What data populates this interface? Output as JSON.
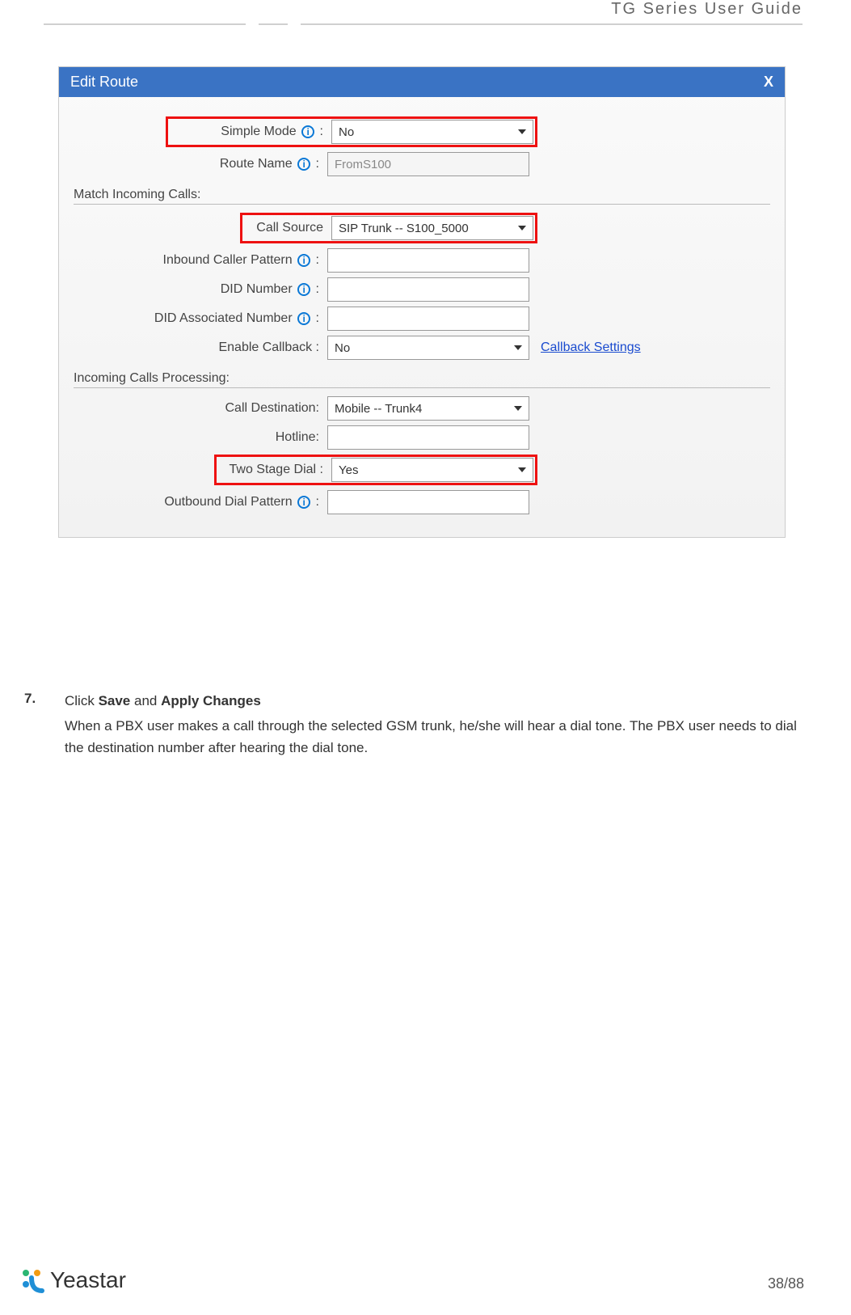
{
  "header": {
    "guide_title": "TG  Series  User  Guide"
  },
  "dialog": {
    "title": "Edit Route",
    "close": "X",
    "simple_mode_label": "Simple Mode",
    "simple_mode_value": "No",
    "route_name_label": "Route Name",
    "route_name_value": "FromS100",
    "match_heading": "Match Incoming Calls:",
    "call_source_label": "Call Source",
    "call_source_value": "SIP Trunk -- S100_5000",
    "inbound_caller_label": "Inbound Caller Pattern",
    "did_number_label": "DID Number",
    "did_assoc_label": "DID Associated Number",
    "enable_callback_label": "Enable Callback :",
    "enable_callback_value": "No",
    "callback_link": "Callback Settings",
    "processing_heading": "Incoming Calls Processing:",
    "call_dest_label": "Call Destination:",
    "call_dest_value": "Mobile -- Trunk4",
    "hotline_label": "Hotline:",
    "two_stage_label": "Two Stage Dial :",
    "two_stage_value": "Yes",
    "outbound_pattern_label": "Outbound Dial Pattern"
  },
  "body": {
    "step_num": "7.",
    "step_line_pre": "Click ",
    "step_bold1": "Save",
    "step_line_mid": " and ",
    "step_bold2": "Apply  Changes",
    "desc": "When a PBX user makes a call through the selected GSM trunk, he/she will hear a dial tone. The PBX user needs to dial the destination number after hearing the dial tone."
  },
  "footer": {
    "brand": "Yeastar",
    "page": "38/88"
  }
}
